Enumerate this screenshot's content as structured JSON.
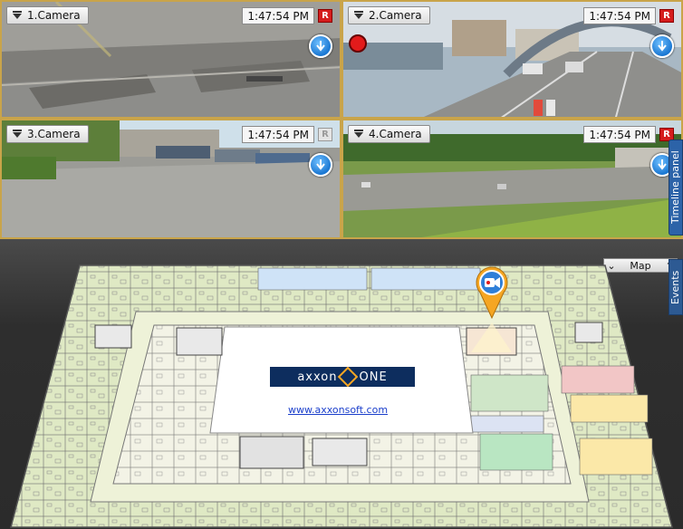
{
  "cameras": [
    {
      "label": "1.Camera",
      "time": "1:47:54 PM",
      "rec": "R",
      "recording": true
    },
    {
      "label": "2.Camera",
      "time": "1:47:54 PM",
      "rec": "R",
      "recording": true
    },
    {
      "label": "3.Camera",
      "time": "1:47:54 PM",
      "rec": "R",
      "recording": false
    },
    {
      "label": "4.Camera",
      "time": "1:47:54 PM",
      "rec": "R",
      "recording": true
    }
  ],
  "map": {
    "title": "Map",
    "logo": {
      "left": "axxon",
      "right": "ONE"
    },
    "url": "www.axxonsoft.com"
  },
  "side_tabs": {
    "timeline": "Timeline panel",
    "events": "Events"
  },
  "colors": {
    "tile_border": "#c9a44a",
    "rec_on": "#d51d1d",
    "side_tab": "#2c63a8",
    "logo_bg": "#0d2d5e",
    "pin_ring": "#f5a623"
  }
}
